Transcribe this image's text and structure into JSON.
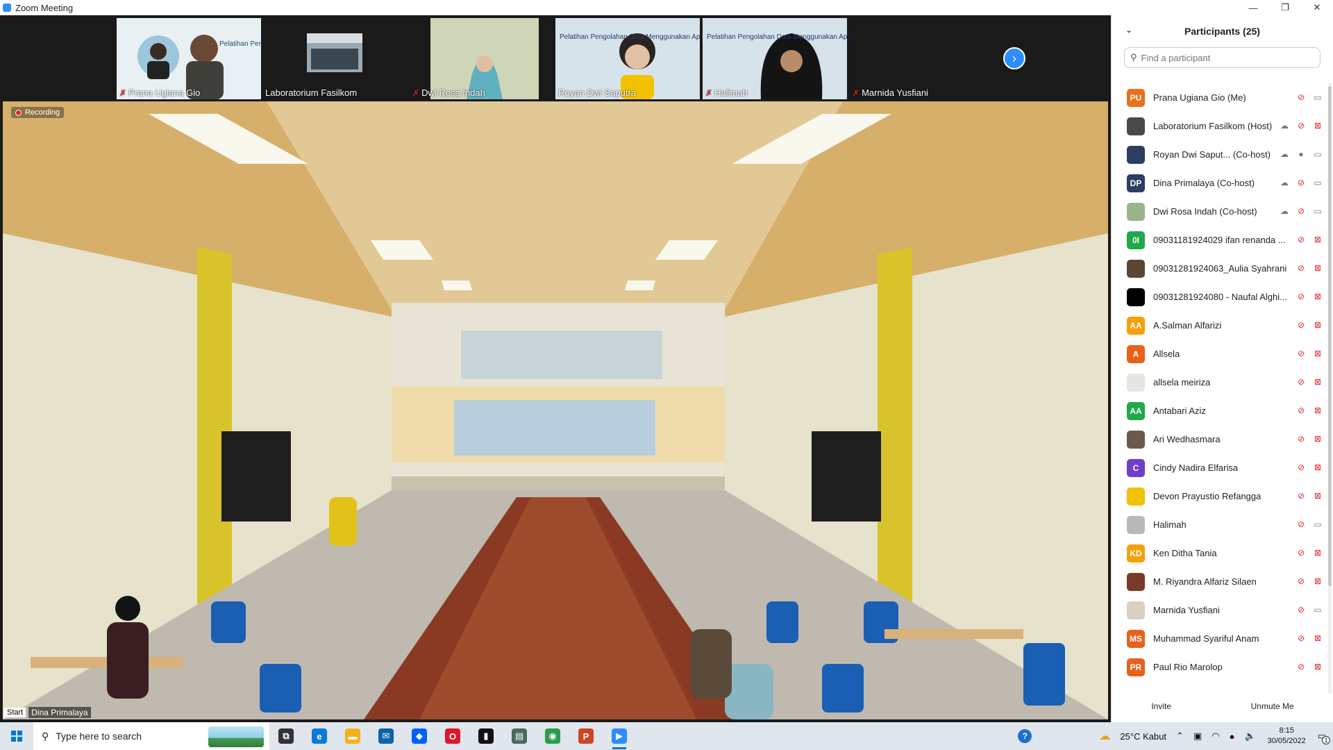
{
  "window": {
    "title": "Zoom Meeting",
    "controls": [
      "—",
      "❐",
      "✕"
    ]
  },
  "gallery": {
    "tiles": [
      {
        "name": "Prana Ugiana Gio",
        "muted": true,
        "bg": "#d8e6ee",
        "poster_text": "Pelatihan Pengolahan Data Menggunakan Aplikasi SmartPLS"
      },
      {
        "name": "Laboratorium Fasilkom",
        "muted": false,
        "bg": "#1a1a1a",
        "poster_text": ""
      },
      {
        "name": "Dwi Rosa Indah",
        "muted": true,
        "bg": "#1a1a1a",
        "poster_text": ""
      },
      {
        "name": "Royan Dwi Saputra",
        "muted": false,
        "bg": "#d6e3ea",
        "poster_text": "Pelatihan Pengolahan Data Menggunakan Aplikasi SmartPLS"
      },
      {
        "name": "Halimah",
        "muted": true,
        "bg": "#d6e3ea",
        "poster_text": "Pelatihan Pengolahan Data Menggunakan Aplikasi SmartPLS"
      },
      {
        "name": "Marnida Yusfiani",
        "muted": true,
        "bg": "#1a1a1a",
        "poster_text": ""
      }
    ],
    "next_icon": "›"
  },
  "main_video": {
    "recording_label": "Recording",
    "start_tag": "Start",
    "speaker_name": "Dina Primalaya"
  },
  "panel": {
    "title": "Participants (25)",
    "collapse_icon": "⌄",
    "search_placeholder": "Find a participant",
    "participants": [
      {
        "name": "Prana Ugiana Gio (Me)",
        "initials": "PU",
        "color": "#e8711a",
        "cloud": false,
        "mic": "muted",
        "video": "on"
      },
      {
        "name": "Laboratorium Fasilkom (Host)",
        "initials": "",
        "color": "#4a4a4a",
        "cloud": true,
        "mic": "muted",
        "video": "off"
      },
      {
        "name": "Royan Dwi Saput...  (Co-host)",
        "initials": "",
        "color": "#2b3e63",
        "cloud": true,
        "mic": "on",
        "video": "on"
      },
      {
        "name": "Dina Primalaya (Co-host)",
        "initials": "DP",
        "color": "#2b3e63",
        "cloud": true,
        "mic": "muted",
        "video": "on"
      },
      {
        "name": "Dwi Rosa Indah (Co-host)",
        "initials": "",
        "color": "#9ab48c",
        "cloud": true,
        "mic": "muted",
        "video": "on"
      },
      {
        "name": "09031181924029 ifan renanda ...",
        "initials": "0I",
        "color": "#1ea94a",
        "cloud": false,
        "mic": "muted",
        "video": "off"
      },
      {
        "name": "09031281924063_Aulia Syahrani",
        "initials": "",
        "color": "#5a4632",
        "cloud": false,
        "mic": "muted",
        "video": "off"
      },
      {
        "name": "09031281924080 - Naufal Alghi...",
        "initials": "",
        "color": "#000000",
        "cloud": false,
        "mic": "muted",
        "video": "off"
      },
      {
        "name": "A.Salman Alfarizi",
        "initials": "AA",
        "color": "#f5a00a",
        "cloud": false,
        "mic": "muted",
        "video": "off"
      },
      {
        "name": "Allsela",
        "initials": "A",
        "color": "#e8611a",
        "cloud": false,
        "mic": "muted",
        "video": "off"
      },
      {
        "name": "allsela meiriza",
        "initials": "",
        "color": "#e8e4df",
        "cloud": false,
        "mic": "muted",
        "video": "off"
      },
      {
        "name": "Antabari Aziz",
        "initials": "AA",
        "color": "#1ea94a",
        "cloud": false,
        "mic": "muted",
        "video": "off"
      },
      {
        "name": "Ari Wedhasmara",
        "initials": "",
        "color": "#6b5a4a",
        "cloud": false,
        "mic": "muted",
        "video": "off"
      },
      {
        "name": "Cindy Nadira Elfarisa",
        "initials": "C",
        "color": "#6e3fc9",
        "cloud": false,
        "mic": "muted",
        "video": "off"
      },
      {
        "name": "Devon Prayustio Refangga",
        "initials": "",
        "color": "#f2c200",
        "cloud": false,
        "mic": "muted",
        "video": "off"
      },
      {
        "name": "Halimah",
        "initials": "",
        "color": "#b9b9b9",
        "cloud": false,
        "mic": "muted",
        "video": "on"
      },
      {
        "name": "Ken Ditha Tania",
        "initials": "KD",
        "color": "#f5a00a",
        "cloud": false,
        "mic": "muted",
        "video": "off"
      },
      {
        "name": "M. Riyandra Alfariz Silaen",
        "initials": "",
        "color": "#7a3a2a",
        "cloud": false,
        "mic": "muted",
        "video": "off"
      },
      {
        "name": "Marnida Yusfiani",
        "initials": "",
        "color": "#d9cfc3",
        "cloud": false,
        "mic": "muted",
        "video": "on"
      },
      {
        "name": "Muhammad Syariful Anam",
        "initials": "MS",
        "color": "#e8611a",
        "cloud": false,
        "mic": "muted",
        "video": "off"
      },
      {
        "name": "Paul Rio Marolop",
        "initials": "PR",
        "color": "#e8611a",
        "cloud": false,
        "mic": "muted",
        "video": "off"
      }
    ],
    "invite_label": "Invite",
    "unmute_label": "Unmute Me"
  },
  "taskbar": {
    "search_placeholder": "Type here to search",
    "apps": [
      {
        "icon": "task-view-icon",
        "glyph": "⧉",
        "color": "#333333"
      },
      {
        "icon": "edge-icon",
        "glyph": "e",
        "color": "#0c7bd6"
      },
      {
        "icon": "file-explorer-icon",
        "glyph": "▬",
        "color": "#f2b21b"
      },
      {
        "icon": "mail-icon",
        "glyph": "✉",
        "color": "#0a64a8"
      },
      {
        "icon": "dropbox-icon",
        "glyph": "◆",
        "color": "#0061fe"
      },
      {
        "icon": "opera-icon",
        "glyph": "O",
        "color": "#e0162b"
      },
      {
        "icon": "terminal-icon",
        "glyph": "▮",
        "color": "#111111"
      },
      {
        "icon": "document-viewer-icon",
        "glyph": "▤",
        "color": "#4a6a5a"
      },
      {
        "icon": "chrome-icon",
        "glyph": "◉",
        "color": "#2a9d4b"
      },
      {
        "icon": "powerpoint-icon",
        "glyph": "P",
        "color": "#d04423"
      },
      {
        "icon": "zoom-icon",
        "glyph": "▶",
        "color": "#2d8cff"
      }
    ],
    "help_icon": "?",
    "weather": "25°C  Kabut",
    "time": "8:15",
    "date": "30/05/2022",
    "notification_count": "1"
  }
}
